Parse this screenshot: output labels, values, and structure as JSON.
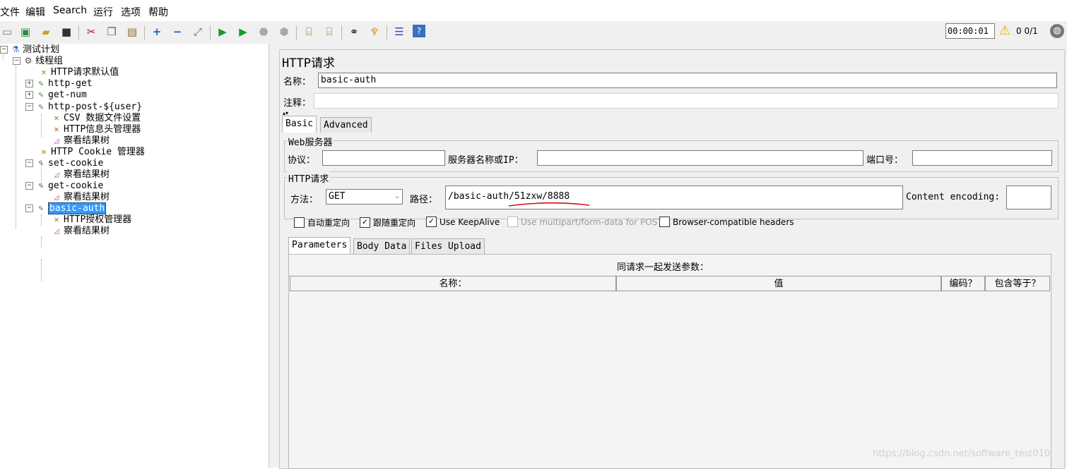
{
  "menu": [
    "文件",
    "编辑",
    "Search",
    "运行",
    "选项",
    "帮助"
  ],
  "toolbar": {
    "timer": "00:00:01",
    "warnings": "0",
    "threads": "0/1"
  },
  "tree": [
    {
      "label": "测试计划"
    },
    {
      "label": "线程组"
    },
    {
      "label": "HTTP请求默认值"
    },
    {
      "label": "http-get"
    },
    {
      "label": "get-num"
    },
    {
      "label": "http-post-${user}"
    },
    {
      "label": "CSV 数据文件设置"
    },
    {
      "label": "HTTP信息头管理器"
    },
    {
      "label": "察看结果树"
    },
    {
      "label": "HTTP Cookie 管理器"
    },
    {
      "label": "set-cookie"
    },
    {
      "label": "察看结果树"
    },
    {
      "label": "get-cookie"
    },
    {
      "label": "察看结果树"
    },
    {
      "label": "basic-auth"
    },
    {
      "label": "HTTP授权管理器"
    },
    {
      "label": "察看结果树"
    }
  ],
  "panel": {
    "title": "HTTP请求",
    "name_label": "名称：",
    "name_value": "basic-auth",
    "comment_label": "注释：",
    "comment_value": "",
    "tabs": [
      "Basic",
      "Advanced"
    ],
    "web_server": {
      "title": "Web服务器",
      "protocol_label": "协议：",
      "protocol_value": "",
      "server_label": "服务器名称或IP：",
      "server_value": "",
      "port_label": "端口号：",
      "port_value": ""
    },
    "http_request": {
      "title": "HTTP请求",
      "method_label": "方法：",
      "method_value": "GET",
      "path_label": "路径：",
      "path_value": "/basic-auth/51zxw/8888",
      "encoding_label": "Content encoding:",
      "encoding_value": ""
    },
    "checkboxes": [
      {
        "label": "自动重定向",
        "checked": false,
        "disabled": false
      },
      {
        "label": "跟随重定向",
        "checked": true,
        "disabled": false
      },
      {
        "label": "Use KeepAlive",
        "checked": true,
        "disabled": false
      },
      {
        "label": "Use multipart/form-data for POST",
        "checked": false,
        "disabled": true
      },
      {
        "label": "Browser-compatible headers",
        "checked": false,
        "disabled": false
      }
    ],
    "subtabs": [
      "Parameters",
      "Body Data",
      "Files Upload"
    ],
    "params_caption": "同请求一起发送参数：",
    "columns": [
      "名称：",
      "值",
      "编码？",
      "包含等于？"
    ]
  },
  "watermark": "https://blog.csdn.net/software_test010",
  "colors": {
    "selection": "#3399ff",
    "annotation": "#d01010"
  }
}
